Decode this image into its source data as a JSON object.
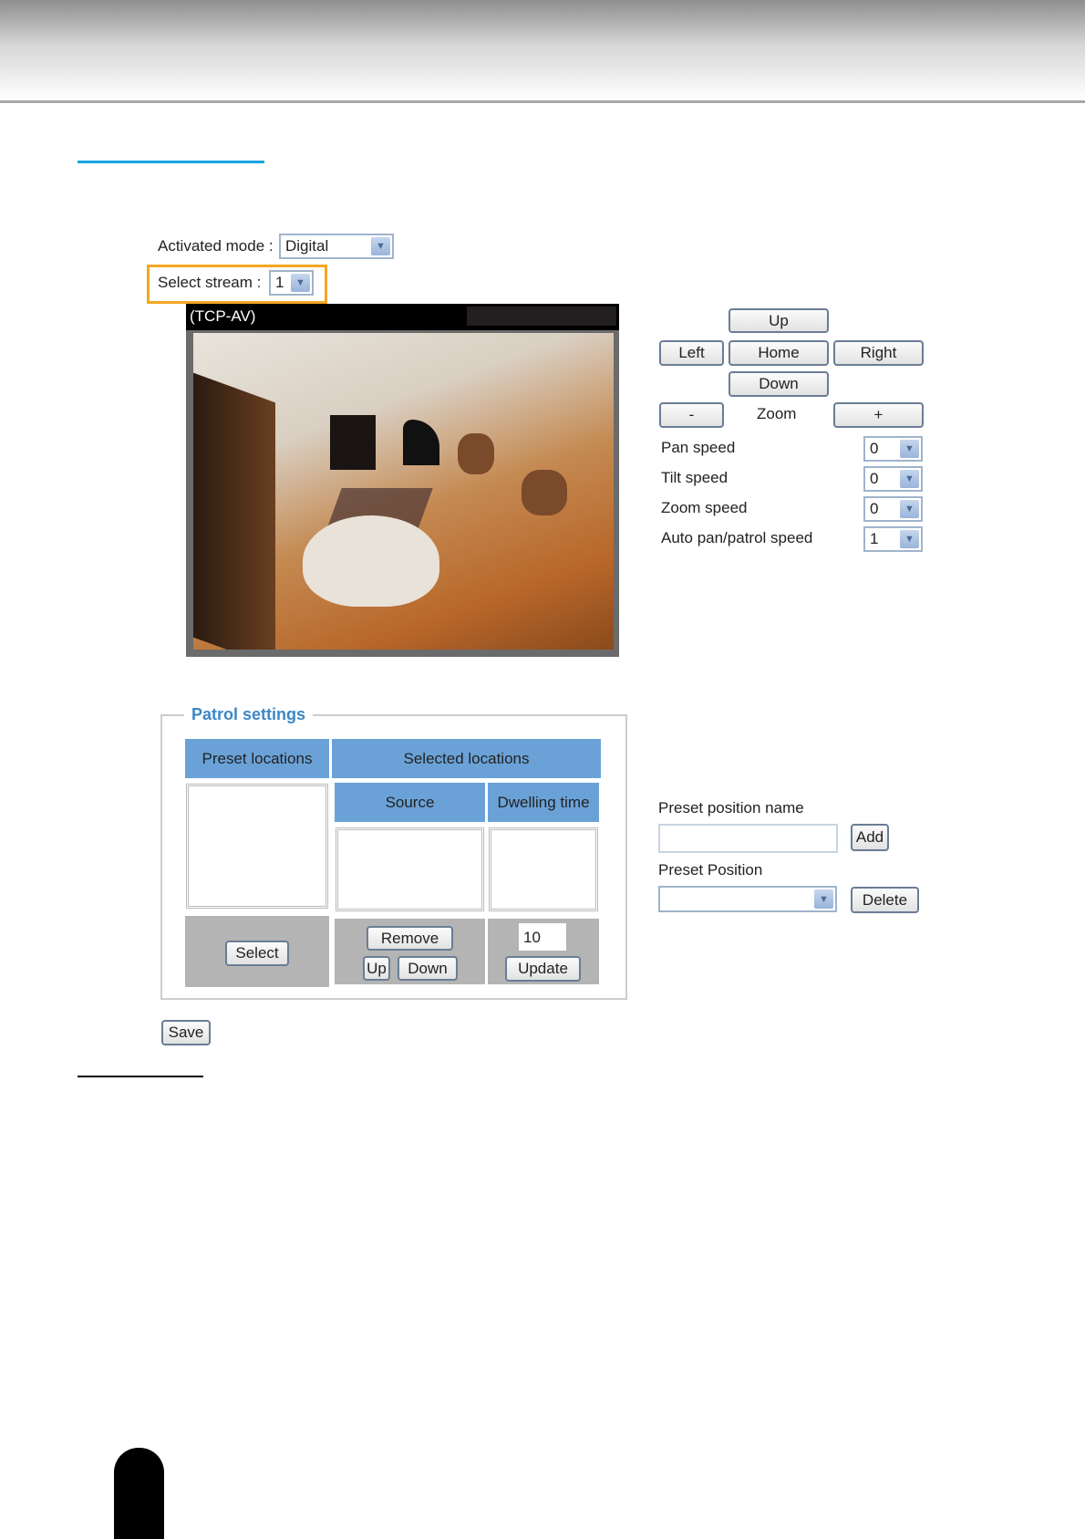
{
  "activated_mode": {
    "label": "Activated mode :",
    "value": "Digital"
  },
  "select_stream": {
    "label": "Select stream :",
    "value": "1"
  },
  "video": {
    "caption": "(TCP-AV)"
  },
  "ptz": {
    "up": "Up",
    "left": "Left",
    "home": "Home",
    "right": "Right",
    "down": "Down",
    "zoom_out": "-",
    "zoom_label": "Zoom",
    "zoom_in": "+"
  },
  "speeds": [
    {
      "label": "Pan speed",
      "value": "0"
    },
    {
      "label": "Tilt speed",
      "value": "0"
    },
    {
      "label": "Zoom speed",
      "value": "0"
    },
    {
      "label": "Auto pan/patrol speed",
      "value": "1"
    }
  ],
  "patrol": {
    "legend": "Patrol settings",
    "preset_locations": "Preset locations",
    "selected_locations": "Selected locations",
    "source": "Source",
    "dwelling_time": "Dwelling time",
    "select": "Select",
    "remove": "Remove",
    "up": "Up",
    "down": "Down",
    "dwell_value": "10",
    "update": "Update"
  },
  "save": "Save",
  "preset": {
    "name_label": "Preset position name",
    "name_value": "",
    "add": "Add",
    "position_label": "Preset Position",
    "position_value": "",
    "delete": "Delete"
  },
  "colors": {
    "accent": "#1aa3e0",
    "highlight": "#f5a623",
    "table_header": "#6aa2d8"
  }
}
